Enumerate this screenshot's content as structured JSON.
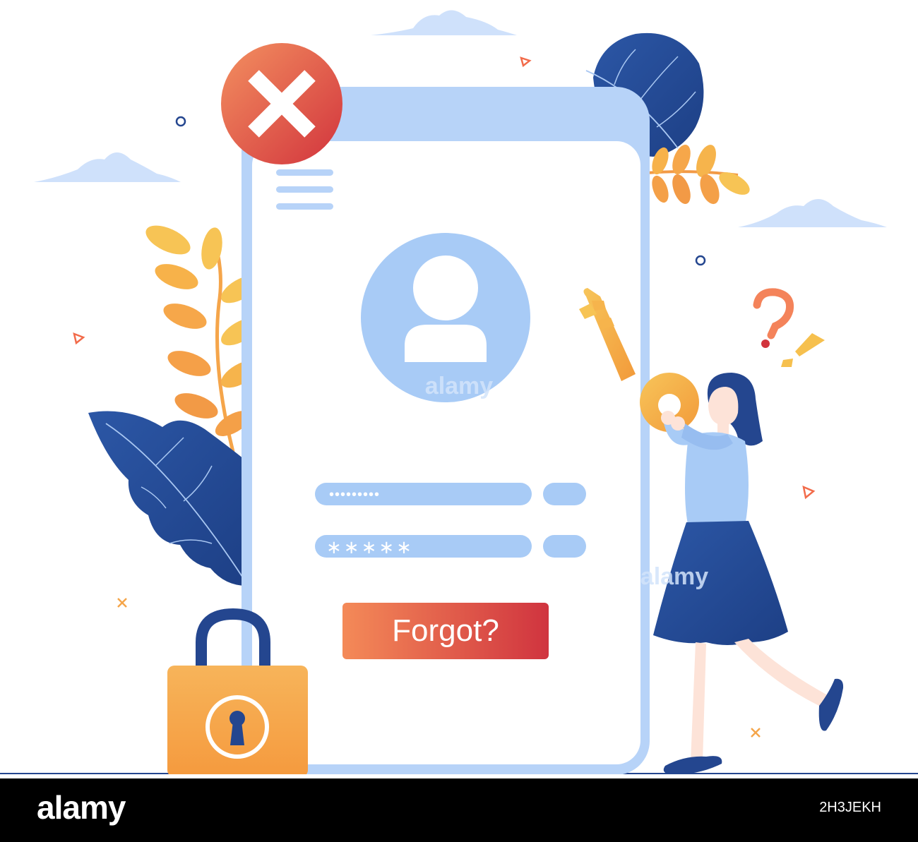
{
  "phone": {
    "forgot_label": "Forgot?",
    "username_mask": "•••••••••",
    "password_mask": "∗∗∗∗∗"
  },
  "watermark": {
    "text_1": "alamy",
    "text_2": "alamy"
  },
  "footer": {
    "logo": "alamy",
    "image_code": "2H3JEKH"
  },
  "colors": {
    "primary_blue": "#8fb9ef",
    "light_blue": "#b7d3f8",
    "navy": "#24468f",
    "orange": "#f5a54a",
    "red": "#d2343d",
    "yellow": "#f6c04e"
  },
  "icons": [
    "close-icon",
    "user-icon",
    "menu-icon",
    "padlock-icon",
    "key-icon",
    "question-mark-icon",
    "exclamation-icon",
    "leaf-icon",
    "cloud-icon"
  ]
}
